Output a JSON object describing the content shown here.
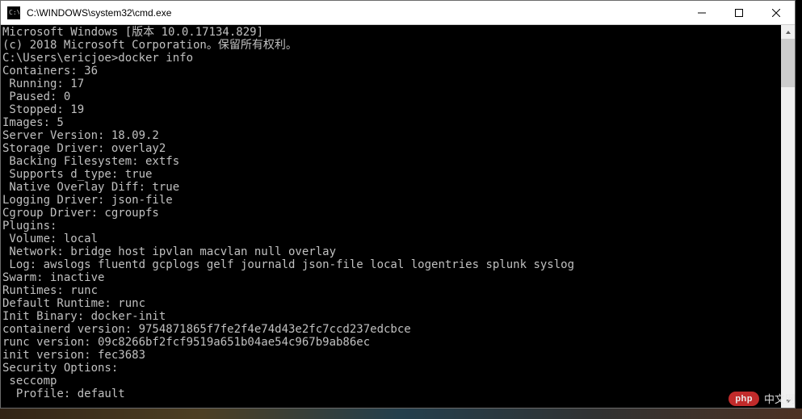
{
  "window": {
    "title": "C:\\WINDOWS\\system32\\cmd.exe"
  },
  "terminal": {
    "lines": [
      "Microsoft Windows [版本 10.0.17134.829]",
      "(c) 2018 Microsoft Corporation。保留所有权利。",
      "",
      "C:\\Users\\ericjoe>docker info",
      "Containers: 36",
      " Running: 17",
      " Paused: 0",
      " Stopped: 19",
      "Images: 5",
      "Server Version: 18.09.2",
      "Storage Driver: overlay2",
      " Backing Filesystem: extfs",
      " Supports d_type: true",
      " Native Overlay Diff: true",
      "Logging Driver: json-file",
      "Cgroup Driver: cgroupfs",
      "Plugins:",
      " Volume: local",
      " Network: bridge host ipvlan macvlan null overlay",
      " Log: awslogs fluentd gcplogs gelf journald json-file local logentries splunk syslog",
      "Swarm: inactive",
      "Runtimes: runc",
      "Default Runtime: runc",
      "Init Binary: docker-init",
      "containerd version: 9754871865f7fe2f4e74d43e2fc7ccd237edcbce",
      "runc version: 09c8266bf2fcf9519a651b04ae54c967b9ab86ec",
      "init version: fec3683",
      "Security Options:",
      " seccomp",
      "  Profile: default"
    ]
  },
  "watermark": {
    "badge": "php",
    "text": "中文网"
  }
}
